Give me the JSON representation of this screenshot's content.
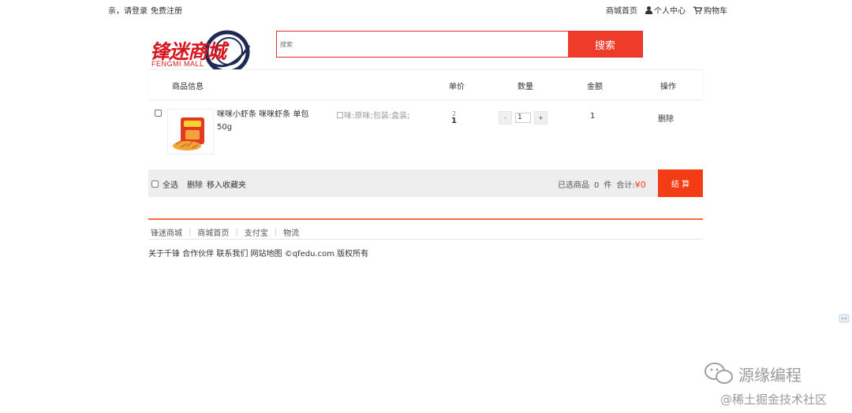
{
  "topbar": {
    "greeting": "亲，请登录",
    "register": "免费注册",
    "mall_home": "商城首页",
    "user_center": "个人中心",
    "cart": "购物车"
  },
  "logo": {
    "cn": "锋迷商城",
    "en": "FENGMI MALL",
    "brand_color": "#d7171f"
  },
  "search": {
    "placeholder": "搜索",
    "button": "搜索",
    "accent": "#ee3b2a"
  },
  "table": {
    "headers": [
      "商品信息",
      "单价",
      "数量",
      "金额",
      "操作"
    ],
    "items": [
      {
        "name": "咪咪小虾条 咪咪虾条 单包50g",
        "attrs": "口味:原味;包装:盒装;",
        "price_old": "2",
        "price": "1",
        "qty_minus": "-",
        "qty": "1",
        "qty_plus": "+",
        "amount": "1",
        "action": "删除"
      }
    ]
  },
  "bar": {
    "select_all": "全选",
    "delete": "删除",
    "move_fav": "移入收藏夹",
    "selected_label": "已选商品",
    "selected_count": "0",
    "unit": "件",
    "total_label": "合计:",
    "total_value": "¥0",
    "checkout": "结 算",
    "checkout_color": "#f33c13"
  },
  "footer": {
    "links": [
      "锋迷商城",
      "商城首页",
      "支付宝",
      "物流"
    ],
    "copyright": "关于千锋 合作伙伴 联系我们 网站地图 ©qfedu.com 版权所有"
  },
  "watermark": {
    "line1": "源缘编程",
    "line2": "@稀土掘金技术社区"
  }
}
